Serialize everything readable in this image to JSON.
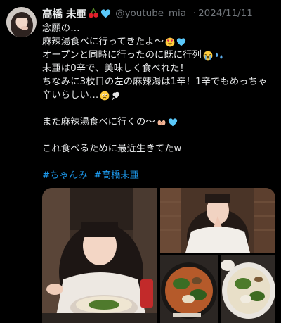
{
  "tweet": {
    "display_name": "高橋 未亜",
    "handle": "@youtube_mia_",
    "separator": "·",
    "date": "2024/11/11",
    "lines": {
      "l1": "念願の…",
      "l2": "麻辣湯食べに行ってきたよ〜",
      "l3": "オープンと同時に行ったのに既に行列",
      "l4": "未亜は0辛で、美味しく食べれた！",
      "l5": "ちなみに3枚目の左の麻辣湯は1辛！1辛でもめっちゃ",
      "l6": "辛いらしい…",
      "l7": "また麻辣湯食べに行くの〜",
      "l8": "これ食べるために最近生きてたw"
    },
    "hashtags": [
      "#ちゃんみ",
      "#高橋未亜"
    ]
  },
  "icons": {
    "name_emojis": [
      "cherry-icon",
      "blue-heart-icon"
    ],
    "line_emojis": [
      "heart-eyes-icon",
      "blue-heart-icon",
      "crying-icon",
      "sweat-drops-icon",
      "holding-tears-icon",
      "thought-bubble-icon",
      "heart-hands-icon",
      "blue-heart-icon"
    ]
  },
  "colors": {
    "background": "#000000",
    "text": "#e7e9ea",
    "muted": "#71767b",
    "link": "#1d9bf0",
    "heart_blue": "#5ac8fa"
  }
}
